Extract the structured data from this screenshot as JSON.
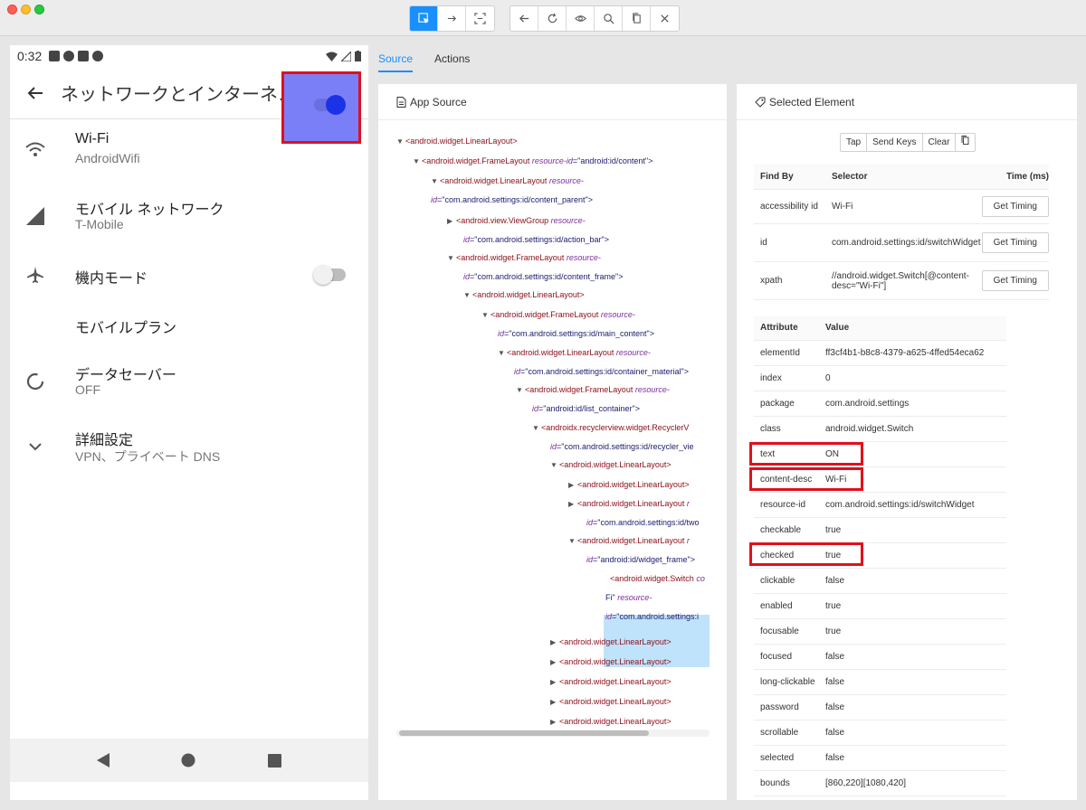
{
  "toolbar": {
    "group1": [
      "select-icon",
      "swipe-icon",
      "tap-coordinates-icon"
    ],
    "group2": [
      "back-icon",
      "refresh-icon",
      "eye-icon",
      "search-icon",
      "copy-icon",
      "close-icon"
    ]
  },
  "device": {
    "status_time": "0:32",
    "appbar_title": "ネットワークとインターネ…",
    "prefs": [
      {
        "title": "Wi-Fi",
        "summary": "AndroidWifi",
        "icon": "wifi-icon"
      },
      {
        "title": "モバイル ネットワーク",
        "summary": "T-Mobile",
        "icon": "signal-icon"
      },
      {
        "title": "機内モード",
        "summary": "",
        "icon": "airplane-icon"
      },
      {
        "title": "モバイルプラン",
        "summary": "",
        "icon": ""
      },
      {
        "title": "データセーバー",
        "summary": "OFF",
        "icon": "data-saver-icon"
      },
      {
        "title": "詳細設定",
        "summary": "VPN、プライベート DNS",
        "icon": "chevron-down-icon"
      }
    ],
    "wifi_toggle": "on",
    "airplane_toggle": "off"
  },
  "tabs": {
    "source": "Source",
    "actions": "Actions"
  },
  "source_panel": {
    "title": "App Source",
    "tree": [
      {
        "tag": "<android.widget.LinearLayout>",
        "arrow": "down"
      },
      {
        "tag": "<android.widget.FrameLayout",
        "attr": "resource-id",
        "val": "=\"android:id/content\">",
        "arrow": "down"
      },
      {
        "tag": "<android.widget.LinearLayout",
        "attr": "resource-",
        "arrow": "down",
        "cont_attr": "id",
        "cont_val": "=\"com.android.settings:id/content_parent\">"
      },
      {
        "tag": "<android.view.ViewGroup",
        "attr": "resource-",
        "arrow": "right",
        "cont_attr": "id",
        "cont_val": "=\"com.android.settings:id/action_bar\">"
      },
      {
        "tag": "<android.widget.FrameLayout",
        "attr": "resource-",
        "arrow": "down",
        "cont_attr": "id",
        "cont_val": "=\"com.android.settings:id/content_frame\">"
      },
      {
        "tag": "<android.widget.LinearLayout>",
        "arrow": "down"
      },
      {
        "tag": "<android.widget.FrameLayout",
        "attr": "resource-",
        "arrow": "down",
        "cont_attr": "id",
        "cont_val": "=\"com.android.settings:id/main_content\">"
      },
      {
        "tag": "<android.widget.LinearLayout",
        "attr": "resource-",
        "arrow": "down",
        "cont_attr": "id",
        "cont_val": "=\"com.android.settings:id/container_material\">"
      },
      {
        "tag": "<android.widget.FrameLayout",
        "attr": "resource-",
        "arrow": "down",
        "cont_attr": "id",
        "cont_val": "=\"android:id/list_container\">"
      },
      {
        "tag": "<androidx.recyclerview.widget.RecyclerV",
        "arrow": "down",
        "cont_attr": "id",
        "cont_val": "=\"com.android.settings:id/recycler_vie"
      },
      {
        "tag": "<android.widget.LinearLayout>",
        "arrow": "down"
      },
      {
        "tag": "<android.widget.LinearLayout>",
        "arrow": "right"
      },
      {
        "tag": "<android.widget.LinearLayout",
        "attr": "r",
        "arrow": "right",
        "cont_attr": "id",
        "cont_val": "=\"com.android.settings:id/two"
      },
      {
        "tag": "<android.widget.LinearLayout",
        "attr": "r",
        "arrow": "down",
        "cont_attr": "id",
        "cont_val": "=\"android:id/widget_frame\">"
      },
      {
        "tag": "<android.widget.Switch",
        "attr": "co",
        "arrow": "none",
        "line2_val": "Fi\"",
        "line2_attr": "resource-",
        "line3_attr": "id",
        "line3_val": "=\"com.android.settings:i"
      },
      {
        "tag": "<android.widget.LinearLayout>",
        "arrow": "right"
      },
      {
        "tag": "<android.widget.LinearLayout>",
        "arrow": "right"
      },
      {
        "tag": "<android.widget.LinearLayout>",
        "arrow": "right"
      },
      {
        "tag": "<android.widget.LinearLayout>",
        "arrow": "right"
      },
      {
        "tag": "<android.widget.LinearLayout>",
        "arrow": "right"
      }
    ]
  },
  "selected_panel": {
    "title": "Selected Element",
    "actions": [
      "Tap",
      "Send Keys",
      "Clear"
    ],
    "find_headers": [
      "Find By",
      "Selector",
      "Time (ms)"
    ],
    "find_rows": [
      {
        "by": "accessibility id",
        "selector": "Wi-Fi",
        "button": "Get Timing"
      },
      {
        "by": "id",
        "selector": "com.android.settings:id/switchWidget",
        "button": "Get Timing"
      },
      {
        "by": "xpath",
        "selector": "//android.widget.Switch[@content-desc=\"Wi-Fi\"]",
        "button": "Get Timing"
      }
    ],
    "attr_headers": [
      "Attribute",
      "Value"
    ],
    "attr_rows": [
      {
        "name": "elementId",
        "value": "ff3cf4b1-b8c8-4379-a625-4ffed54eca62"
      },
      {
        "name": "index",
        "value": "0"
      },
      {
        "name": "package",
        "value": "com.android.settings"
      },
      {
        "name": "class",
        "value": "android.widget.Switch"
      },
      {
        "name": "text",
        "value": "ON"
      },
      {
        "name": "content-desc",
        "value": "Wi-Fi"
      },
      {
        "name": "resource-id",
        "value": "com.android.settings:id/switchWidget"
      },
      {
        "name": "checkable",
        "value": "true"
      },
      {
        "name": "checked",
        "value": "true"
      },
      {
        "name": "clickable",
        "value": "false"
      },
      {
        "name": "enabled",
        "value": "true"
      },
      {
        "name": "focusable",
        "value": "true"
      },
      {
        "name": "focused",
        "value": "false"
      },
      {
        "name": "long-clickable",
        "value": "false"
      },
      {
        "name": "password",
        "value": "false"
      },
      {
        "name": "scrollable",
        "value": "false"
      },
      {
        "name": "selected",
        "value": "false"
      },
      {
        "name": "bounds",
        "value": "[860,220][1080,420]"
      }
    ]
  },
  "colors": {
    "accent": "#1890ff",
    "highlight": "#e0101c",
    "tag": "#8b0d19",
    "attr": "#7c2e9e"
  }
}
